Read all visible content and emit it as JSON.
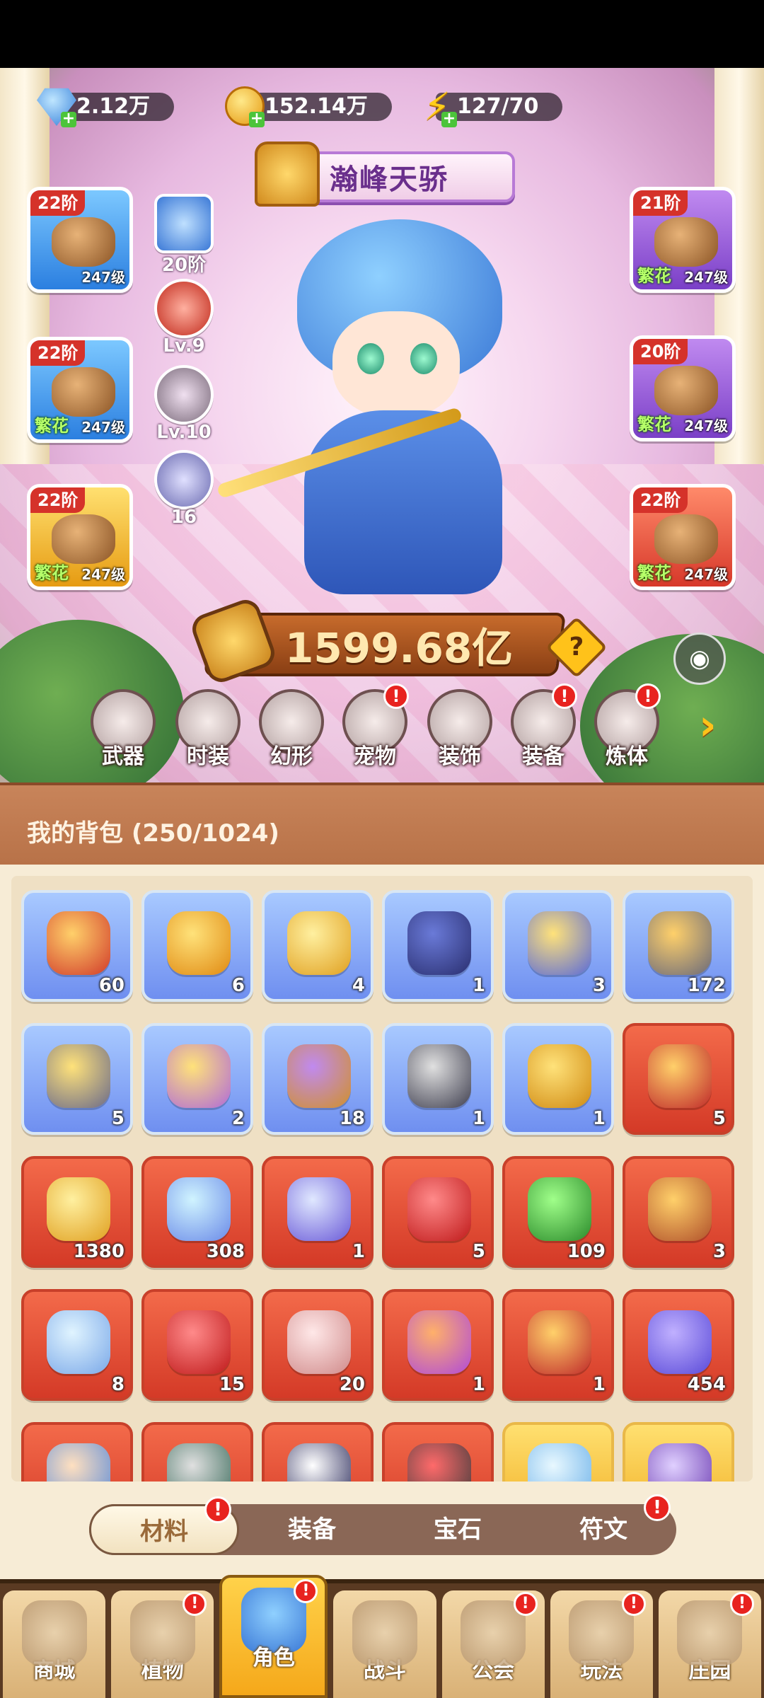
{
  "currencies": [
    {
      "name": "gem",
      "value": "2.12万"
    },
    {
      "name": "coin",
      "value": "152.14万"
    },
    {
      "name": "energy",
      "value": "127/70"
    }
  ],
  "title": "瀚峰天骄",
  "equip_left": [
    {
      "tier": "22阶",
      "level": "247级",
      "quality": ""
    },
    {
      "tier": "22阶",
      "level": "247级",
      "quality": "繁花"
    },
    {
      "tier": "22阶",
      "level": "247级",
      "quality": "繁花"
    }
  ],
  "equip_right": [
    {
      "tier": "21阶",
      "level": "247级",
      "quality": "繁花"
    },
    {
      "tier": "20阶",
      "level": "247级",
      "quality": "繁花"
    },
    {
      "tier": "22阶",
      "level": "247级",
      "quality": "繁花"
    }
  ],
  "mini_stats": [
    "20阶",
    "Lv.9",
    "Lv.10",
    "16"
  ],
  "power": "1599.68亿",
  "help_label": "?",
  "functions": [
    {
      "label": "武器",
      "badge": ""
    },
    {
      "label": "时装",
      "badge": ""
    },
    {
      "label": "幻形",
      "badge": ""
    },
    {
      "label": "宠物",
      "badge": "!"
    },
    {
      "label": "装饰",
      "badge": ""
    },
    {
      "label": "装备",
      "badge": "!"
    },
    {
      "label": "炼体",
      "badge": "!"
    }
  ],
  "bag": {
    "title": "我的背包 (250/1024)",
    "items": [
      {
        "count": "60",
        "rarity": "blue",
        "c1": "#ffd06a",
        "c2": "#d13b2a"
      },
      {
        "count": "6",
        "rarity": "blue",
        "c1": "#ffe27a",
        "c2": "#e08a12"
      },
      {
        "count": "4",
        "rarity": "blue",
        "c1": "#fff0a0",
        "c2": "#e0a020"
      },
      {
        "count": "1",
        "rarity": "blue",
        "c1": "#6a7ad8",
        "c2": "#2a2f70"
      },
      {
        "count": "3",
        "rarity": "blue",
        "c1": "#ffe27a",
        "c2": "#5a6ad8"
      },
      {
        "count": "172",
        "rarity": "blue",
        "c1": "#ffd06a",
        "c2": "#6a6a7a"
      },
      {
        "count": "5",
        "rarity": "blue",
        "c1": "#ffe27a",
        "c2": "#6a6a8a"
      },
      {
        "count": "2",
        "rarity": "blue",
        "c1": "#ffe27a",
        "c2": "#b06ad8"
      },
      {
        "count": "18",
        "rarity": "blue",
        "c1": "#c08af0",
        "c2": "#d0902a"
      },
      {
        "count": "1",
        "rarity": "blue",
        "c1": "#e0e0e0",
        "c2": "#404050"
      },
      {
        "count": "1",
        "rarity": "blue",
        "c1": "#ffe27a",
        "c2": "#d08a12"
      },
      {
        "count": "5",
        "rarity": "red",
        "c1": "#ffd06a",
        "c2": "#c02a2a"
      },
      {
        "count": "1380",
        "rarity": "red",
        "c1": "#fff0a0",
        "c2": "#e0a020"
      },
      {
        "count": "308",
        "rarity": "red",
        "c1": "#d0f4ff",
        "c2": "#6a8ae8"
      },
      {
        "count": "1",
        "rarity": "red",
        "c1": "#e0e8ff",
        "c2": "#6a5ad8"
      },
      {
        "count": "5",
        "rarity": "red",
        "c1": "#ff8a8a",
        "c2": "#c01a1a"
      },
      {
        "count": "109",
        "rarity": "red",
        "c1": "#a0ff8a",
        "c2": "#2a8a2a"
      },
      {
        "count": "3",
        "rarity": "red",
        "c1": "#ffd06a",
        "c2": "#b0502a"
      },
      {
        "count": "8",
        "rarity": "red",
        "c1": "#e0f4ff",
        "c2": "#7aa8e8"
      },
      {
        "count": "15",
        "rarity": "red",
        "c1": "#ff8a8a",
        "c2": "#c01a1a"
      },
      {
        "count": "20",
        "rarity": "red",
        "c1": "#ffe8e8",
        "c2": "#d08a8a"
      },
      {
        "count": "1",
        "rarity": "red",
        "c1": "#ffb06a",
        "c2": "#b04ad8"
      },
      {
        "count": "1",
        "rarity": "red",
        "c1": "#ffd06a",
        "c2": "#c02a2a"
      },
      {
        "count": "454",
        "rarity": "red",
        "c1": "#c0b0ff",
        "c2": "#5a4ad8"
      },
      {
        "count": "",
        "rarity": "red",
        "c1": "#ffe0c0",
        "c2": "#5a8ad8"
      },
      {
        "count": "",
        "rarity": "red",
        "c1": "#e0e0e0",
        "c2": "#3a6a5a"
      },
      {
        "count": "",
        "rarity": "red",
        "c1": "#ffffff",
        "c2": "#2a2a5a"
      },
      {
        "count": "",
        "rarity": "red",
        "c1": "#ff6a6a",
        "c2": "#3a3a3a"
      },
      {
        "count": "",
        "rarity": "gold",
        "c1": "#e8f8ff",
        "c2": "#6ab0e8"
      },
      {
        "count": "",
        "rarity": "gold",
        "c1": "#e0d0ff",
        "c2": "#6a3ab0"
      }
    ]
  },
  "category_tabs": [
    {
      "label": "材料",
      "active": true,
      "badge": "!"
    },
    {
      "label": "装备",
      "active": false,
      "badge": ""
    },
    {
      "label": "宝石",
      "active": false,
      "badge": ""
    },
    {
      "label": "符文",
      "active": false,
      "badge": "!"
    }
  ],
  "nav": [
    {
      "label": "商城",
      "active": false,
      "badge": ""
    },
    {
      "label": "植物",
      "active": false,
      "badge": "!"
    },
    {
      "label": "角色",
      "active": true,
      "badge": "!"
    },
    {
      "label": "战斗",
      "active": false,
      "badge": ""
    },
    {
      "label": "公会",
      "active": false,
      "badge": "!"
    },
    {
      "label": "玩法",
      "active": false,
      "badge": "!"
    },
    {
      "label": "庄园",
      "active": false,
      "badge": "!"
    }
  ]
}
